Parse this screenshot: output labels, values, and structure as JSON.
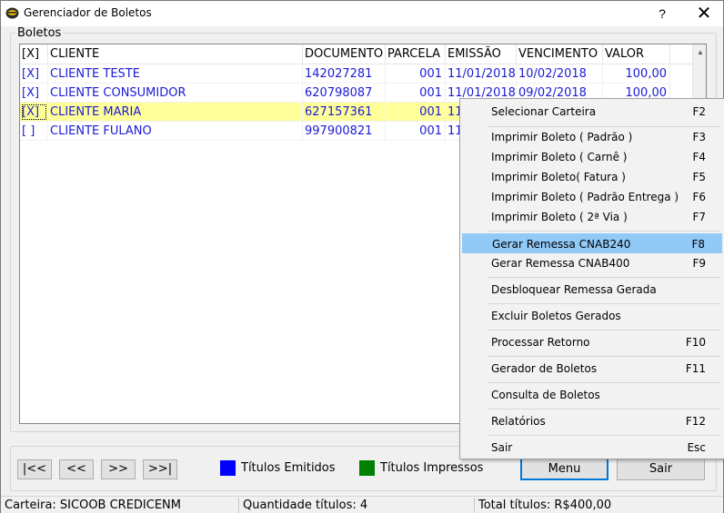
{
  "window": {
    "title": "Gerenciador de Boletos",
    "help_glyph": "?",
    "close_glyph": "✕"
  },
  "group": {
    "label": "Boletos"
  },
  "grid": {
    "columns": [
      "[X]",
      "CLIENTE",
      "DOCUMENTO",
      "PARCELA",
      "EMISSÃO",
      "VENCIMENTO",
      "VALOR"
    ],
    "rows": [
      {
        "check": "[X]",
        "cliente": "CLIENTE TESTE",
        "documento": "142027281",
        "parcela": "001",
        "emissao": "11/01/2018",
        "vencimento": "10/02/2018",
        "valor": "100,00"
      },
      {
        "check": "[X]",
        "cliente": "CLIENTE CONSUMIDOR",
        "documento": "620798087",
        "parcela": "001",
        "emissao": "11/01/2018",
        "vencimento": "09/02/2018",
        "valor": "100,00"
      },
      {
        "check": "[X]",
        "cliente": "CLIENTE MARIA",
        "documento": "627157361",
        "parcela": "001",
        "emissao": "11",
        "vencimento": "",
        "valor": ""
      },
      {
        "check": "[ ]",
        "cliente": "CLIENTE FULANO",
        "documento": "997900821",
        "parcela": "001",
        "emissao": "11",
        "vencimento": "",
        "valor": ""
      }
    ],
    "selected_row_color": "#ffff99",
    "text_color": "#1a1ad4"
  },
  "nav": {
    "first": "|<<",
    "prev": "<<",
    "next": ">>",
    "last": ">>|"
  },
  "legend": {
    "emitidos": {
      "label": "Títulos Emitidos",
      "color": "#0000ff"
    },
    "impressos": {
      "label": "Títulos Impressos",
      "color": "#008000"
    }
  },
  "buttons": {
    "menu": "Menu",
    "sair": "Sair"
  },
  "status": {
    "carteira": "Carteira: SICOOB CREDICENM",
    "quantidade": "Quantidade títulos: 4",
    "total": "Total títulos: R$400,00"
  },
  "menu": {
    "items": [
      {
        "label": "Selecionar Carteira",
        "key": "F2"
      },
      {
        "label": "Imprimir Boleto ( Padrão )",
        "key": "F3"
      },
      {
        "label": "Imprimir Boleto ( Carnê )",
        "key": "F4"
      },
      {
        "label": "Imprimir Boleto( Fatura )",
        "key": "F5"
      },
      {
        "label": "Imprimir Boleto ( Padrão Entrega )",
        "key": "F6"
      },
      {
        "label": "Imprimir Boleto ( 2ª Via )",
        "key": "F7"
      },
      {
        "label": "Gerar Remessa CNAB240",
        "key": "F8"
      },
      {
        "label": "Gerar Remessa CNAB400",
        "key": "F9"
      },
      {
        "label": "Desbloquear Remessa Gerada",
        "key": ""
      },
      {
        "label": "Excluir Boletos Gerados",
        "key": ""
      },
      {
        "label": "Processar Retorno",
        "key": "F10"
      },
      {
        "label": "Gerador de Boletos",
        "key": "F11"
      },
      {
        "label": "Consulta de Boletos",
        "key": ""
      },
      {
        "label": "Relatórios",
        "key": "F12"
      },
      {
        "label": "Sair",
        "key": "Esc"
      }
    ],
    "highlight_color": "#91c9f7"
  }
}
